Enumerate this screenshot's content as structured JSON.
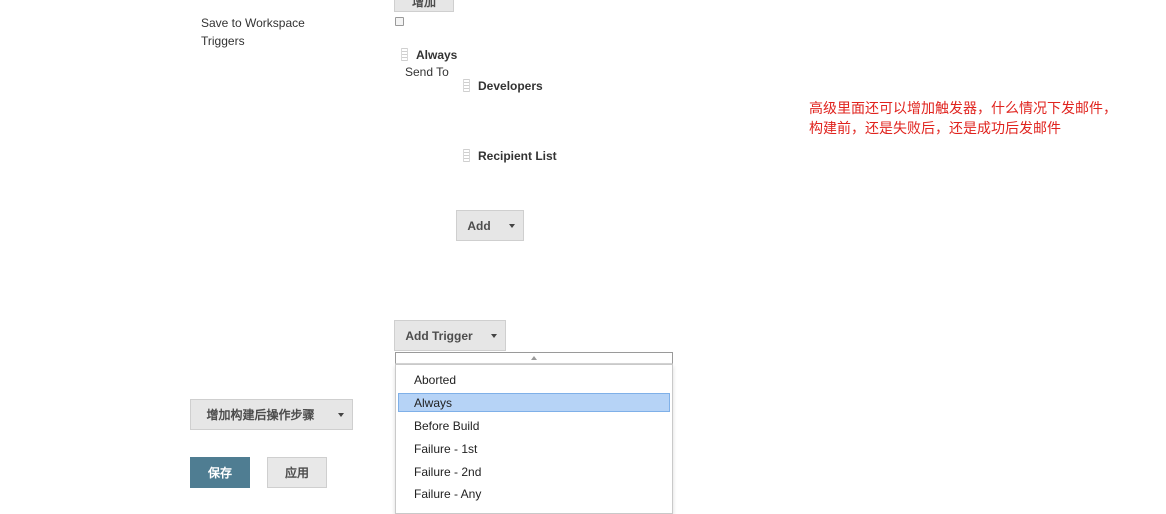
{
  "top_button_label": "增加",
  "left_labels": {
    "save_to_workspace": "Save to Workspace",
    "triggers": "Triggers"
  },
  "trigger": {
    "name": "Always",
    "send_to_label": "Send To",
    "recipients": [
      "Developers",
      "Recipient List"
    ],
    "add_label": "Add"
  },
  "add_trigger_label": "Add Trigger",
  "dropdown_items": [
    "Aborted",
    "Always",
    "Before Build",
    "Failure - 1st",
    "Failure - 2nd",
    "Failure - Any"
  ],
  "dropdown_selected": "Always",
  "post_build_label": "增加构建后操作步骤",
  "save_label": "保存",
  "apply_label": "应用",
  "annotation": {
    "line1": "高级里面还可以增加触发器，什么情况下发邮件，",
    "line2": "构建前，还是失败后，还是成功后发邮件"
  },
  "colors": {
    "save_button": "#4f7d92",
    "selected_item": "#b6d3f6",
    "annotation_text": "#e0231e"
  },
  "icons": [
    "drag-handle-icon",
    "caret-down-icon",
    "scroll-up-arrow-icon",
    "checkbox"
  ]
}
